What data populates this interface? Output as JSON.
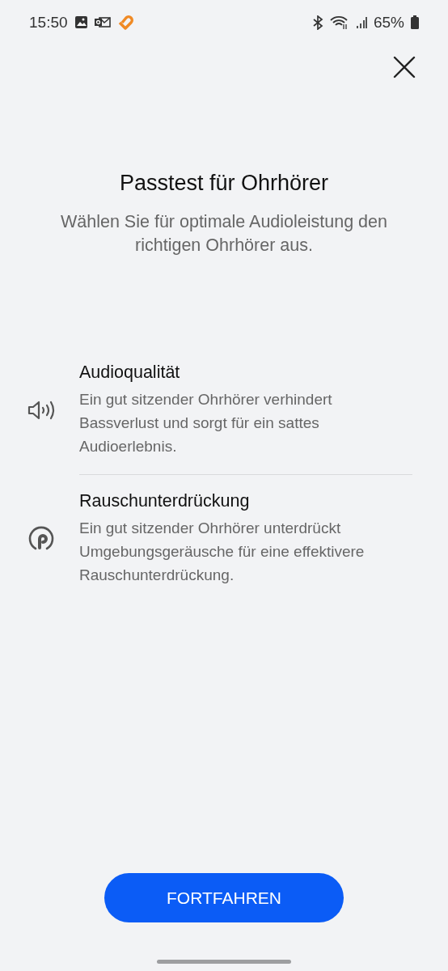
{
  "status_bar": {
    "time": "15:50",
    "battery": "65%"
  },
  "title": "Passtest für Ohrhörer",
  "subtitle": "Wählen Sie für optimale Audioleistung den richtigen Ohrhörer aus.",
  "features": [
    {
      "kind": "speaker",
      "title": "Audioqualität",
      "description": "Ein gut sitzender Ohrhörer verhindert Bassverlust und sorgt für ein sattes Audioerlebnis."
    },
    {
      "kind": "earbud",
      "title": "Rauschunterdrückung",
      "description": "Ein gut sitzender Ohrhörer unterdrückt Umgebungsgeräusche für eine effektivere Rauschunterdrückung."
    }
  ],
  "button": "FORTFAHREN"
}
